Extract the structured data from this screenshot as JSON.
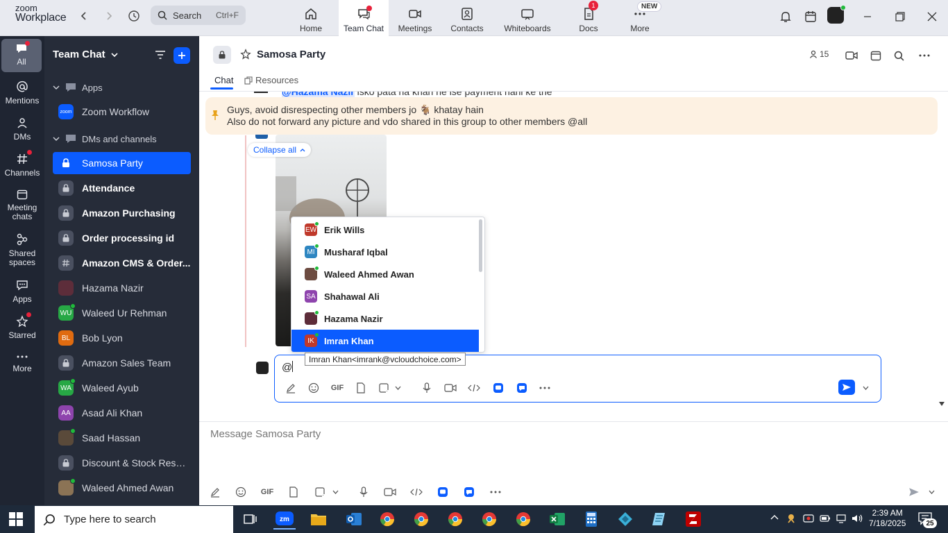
{
  "app": {
    "logo_line1": "zoom",
    "logo_line2": "Workplace"
  },
  "topbar": {
    "search_label": "Search",
    "search_shortcut": "Ctrl+F",
    "tabs": [
      {
        "label": "Home",
        "icon": "home-icon"
      },
      {
        "label": "Team Chat",
        "icon": "chat-icon"
      },
      {
        "label": "Meetings",
        "icon": "video-icon"
      },
      {
        "label": "Contacts",
        "icon": "contacts-icon"
      },
      {
        "label": "Whiteboards",
        "icon": "whiteboard-icon"
      },
      {
        "label": "Docs",
        "icon": "docs-icon",
        "badge": "1"
      },
      {
        "label": "More",
        "icon": "more-icon",
        "badge": "NEW"
      }
    ]
  },
  "rail": {
    "items": [
      {
        "label": "All",
        "icon": "chat-bubble-icon"
      },
      {
        "label": "Mentions",
        "icon": "at-icon"
      },
      {
        "label": "DMs",
        "icon": "people-icon"
      },
      {
        "label": "Channels",
        "icon": "hash-icon"
      },
      {
        "label_line1": "Meeting",
        "label_line2": "chats",
        "icon": "calendar-icon"
      },
      {
        "label_line1": "Shared",
        "label_line2": "spaces",
        "icon": "shared-spaces-icon"
      },
      {
        "label": "Apps",
        "icon": "apps-icon"
      },
      {
        "label": "Starred",
        "icon": "star-icon"
      },
      {
        "label": "More",
        "icon": "ellipsis-icon"
      }
    ]
  },
  "panel": {
    "title": "Team Chat",
    "section_apps": "Apps",
    "zoom_workflow": "Zoom Workflow",
    "zoom_workflow_av": "zoom",
    "section_dms": "DMs and channels",
    "channels": [
      {
        "name": "Samosa Party"
      },
      {
        "name": "Attendance"
      },
      {
        "name": "Amazon Purchasing"
      },
      {
        "name": "Order processing id"
      },
      {
        "name": "Amazon CMS & Order..."
      },
      {
        "name": "Hazama Nazir"
      },
      {
        "name": "Waleed Ur Rehman",
        "initials": "WU"
      },
      {
        "name": "Bob Lyon",
        "initials": "BL"
      },
      {
        "name": "Amazon Sales Team"
      },
      {
        "name": "Waleed Ayub",
        "initials": "WA"
      },
      {
        "name": "Asad Ali Khan",
        "initials": "AA"
      },
      {
        "name": "Saad Hassan"
      },
      {
        "name": "Discount & Stock Reser..."
      },
      {
        "name": "Waleed Ahmed Awan"
      }
    ]
  },
  "chat": {
    "name": "Samosa Party",
    "member_count": "15",
    "tab_chat": "Chat",
    "tab_resources": "Resources",
    "cut_message_mention": "@Hazama Nazir",
    "cut_message_text": " isko pata na khan ne ise payment nahi ke the",
    "pinned_line1": "Guys, avoid disrespecting other members jo 🐐 khatay hain",
    "pinned_line2": "Also do not forward any picture and vdo shared in this group to other members @all",
    "collapse_all": "Collapse all"
  },
  "mention_popup": {
    "items": [
      {
        "name": "Erik Wills",
        "initials": "EW",
        "color": "#c0392b"
      },
      {
        "name": "Musharaf Iqbal",
        "initials": "MI",
        "color": "#2e86c1"
      },
      {
        "name": "Waleed Ahmed Awan",
        "initials": "",
        "color": "#6d4c41"
      },
      {
        "name": "Shahawal Ali",
        "initials": "SA",
        "color": "#8e44ad"
      },
      {
        "name": "Hazama Nazir",
        "initials": "",
        "color": "#5d2d3a"
      },
      {
        "name": "Imran Khan",
        "initials": "IK",
        "color": "#c0392b"
      }
    ],
    "tooltip": "Imran Khan<imrank@vcloudchoice.com>"
  },
  "reply": {
    "text": "@"
  },
  "composer": {
    "placeholder": "Message Samosa Party",
    "gif_label": "GIF"
  },
  "taskbar": {
    "search_placeholder": "Type here to search",
    "time": "2:39 AM",
    "date": "7/18/2025",
    "notification_count": "25"
  },
  "colors": {
    "accent": "#0b5cff",
    "online": "#1fba3a",
    "badge": "#e8223b",
    "pinned_bg": "#fdf1e2"
  }
}
